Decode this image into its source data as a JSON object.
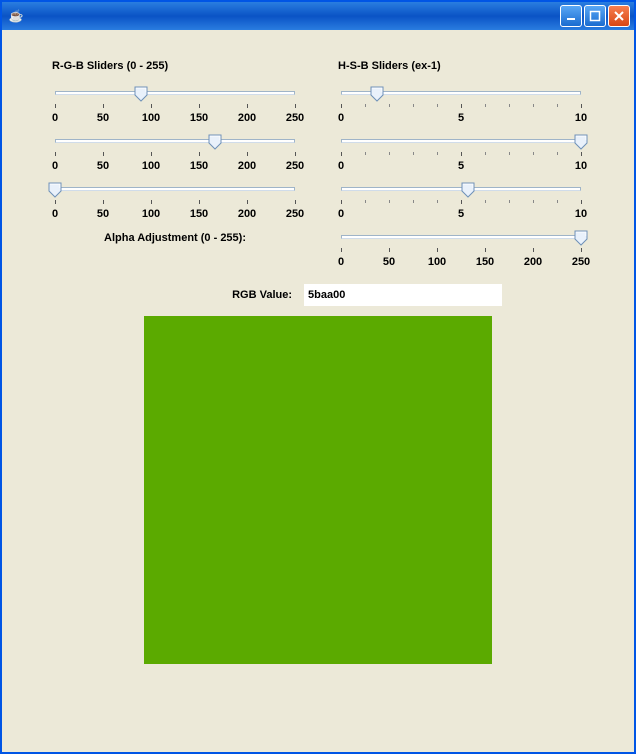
{
  "window": {
    "title": ""
  },
  "icons": {
    "java": "☕"
  },
  "rgb": {
    "header": "R-G-B Sliders (0 - 255)",
    "scale": [
      "0",
      "50",
      "100",
      "150",
      "200",
      "250"
    ],
    "sliders": [
      {
        "name": "red-slider",
        "value": 91,
        "max": 255
      },
      {
        "name": "green-slider",
        "value": 170,
        "max": 255
      },
      {
        "name": "blue-slider",
        "value": 0,
        "max": 255
      }
    ],
    "alpha_label": "Alpha Adjustment (0 - 255):"
  },
  "hsb": {
    "header": "H-S-B Sliders (ex-1)",
    "scale10": [
      "0",
      "5",
      "10"
    ],
    "sliders": [
      {
        "name": "hue-slider",
        "value": 1.5,
        "max": 10
      },
      {
        "name": "saturation-slider",
        "value": 10,
        "max": 10
      },
      {
        "name": "brightness-slider",
        "value": 5.3,
        "max": 10
      }
    ],
    "alpha": {
      "name": "alpha-slider",
      "value": 255,
      "max": 255
    },
    "scale255": [
      "0",
      "50",
      "100",
      "150",
      "200",
      "250"
    ]
  },
  "value": {
    "label": "RGB Value:",
    "text": "5baa00"
  },
  "swatch_color": "#5baa00"
}
